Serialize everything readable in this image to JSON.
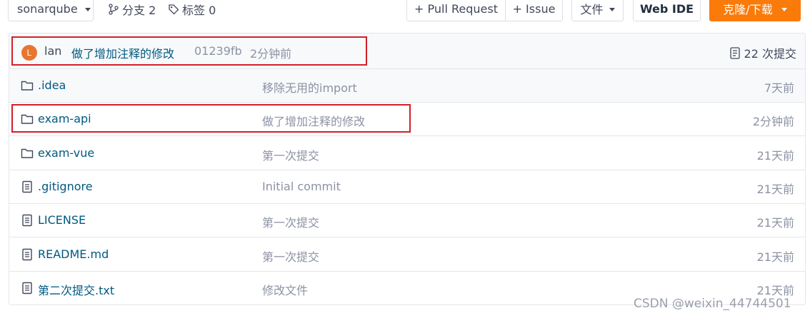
{
  "toolbar": {
    "branch_select": "sonarqube",
    "branches_label": "分支 2",
    "tags_label": "标签 0",
    "pull_request": "+ Pull Request",
    "issue": "+ Issue",
    "file_menu": "文件",
    "web_ide": "Web IDE",
    "clone_download": "克隆/下载"
  },
  "latest_commit": {
    "avatar_letter": "L",
    "author": "lan",
    "message": "做了增加注释的修改",
    "sha": "01239fb",
    "time": "2分钟前",
    "commit_count": "22 次提交"
  },
  "files": [
    {
      "name": ".idea",
      "type": "folder",
      "message": "移除无用的import",
      "time": "7天前"
    },
    {
      "name": "exam-api",
      "type": "folder",
      "message": "做了增加注释的修改",
      "time": "2分钟前"
    },
    {
      "name": "exam-vue",
      "type": "folder",
      "message": "第一次提交",
      "time": "21天前"
    },
    {
      "name": ".gitignore",
      "type": "file",
      "message": "Initial commit",
      "time": "21天前"
    },
    {
      "name": "LICENSE",
      "type": "file",
      "message": "第一次提交",
      "time": "21天前"
    },
    {
      "name": "README.md",
      "type": "file",
      "message": "第一次提交",
      "time": "21天前"
    },
    {
      "name": "第二次提交.txt",
      "type": "file",
      "message": "修改文件",
      "time": "21天前"
    }
  ],
  "watermark": "CSDN @weixin_44744501",
  "colors": {
    "accent_orange": "#fa7a0a",
    "link_blue": "#005980",
    "highlight_red": "#d0202a",
    "muted_text": "#8c92a4"
  }
}
